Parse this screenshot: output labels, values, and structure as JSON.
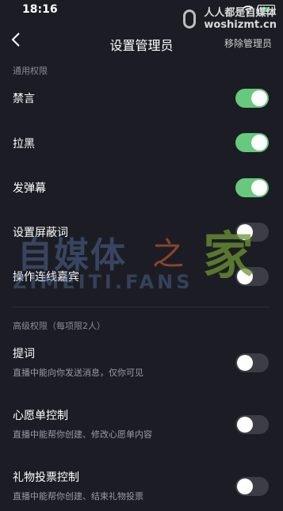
{
  "status_bar": {
    "time": "18:16"
  },
  "watermark_top": {
    "line1": "人人都是自媒体",
    "line2": "woshizmt.cn"
  },
  "nav": {
    "title": "设置管理员",
    "action": "移除管理员"
  },
  "sections": {
    "common": {
      "title": "通用权限",
      "items": [
        {
          "label": "禁言",
          "on": true
        },
        {
          "label": "拉黑",
          "on": true
        },
        {
          "label": "发弹幕",
          "on": true
        },
        {
          "label": "设置屏蔽词",
          "on": false
        },
        {
          "label": "操作连线嘉宾",
          "on": false
        }
      ]
    },
    "advanced": {
      "title": "高级权限（每项限2人）",
      "items": [
        {
          "label": "提词",
          "desc": "直播中能向你发送消息，仅你可见",
          "on": false
        },
        {
          "label": "心愿单控制",
          "desc": "直播中能帮你创建、修改心愿单内容",
          "on": false
        },
        {
          "label": "礼物投票控制",
          "desc": "直播中能帮你创建、结束礼物投票",
          "on": false
        }
      ]
    }
  },
  "watermark_center": {
    "cn": "自媒体",
    "zhi": "之",
    "jia": "家",
    "en": "ZIMEITI.FANS"
  },
  "colors": {
    "toggle_on": "#67c97e",
    "toggle_off": "#3d3e45",
    "background": "#1c1d24"
  }
}
